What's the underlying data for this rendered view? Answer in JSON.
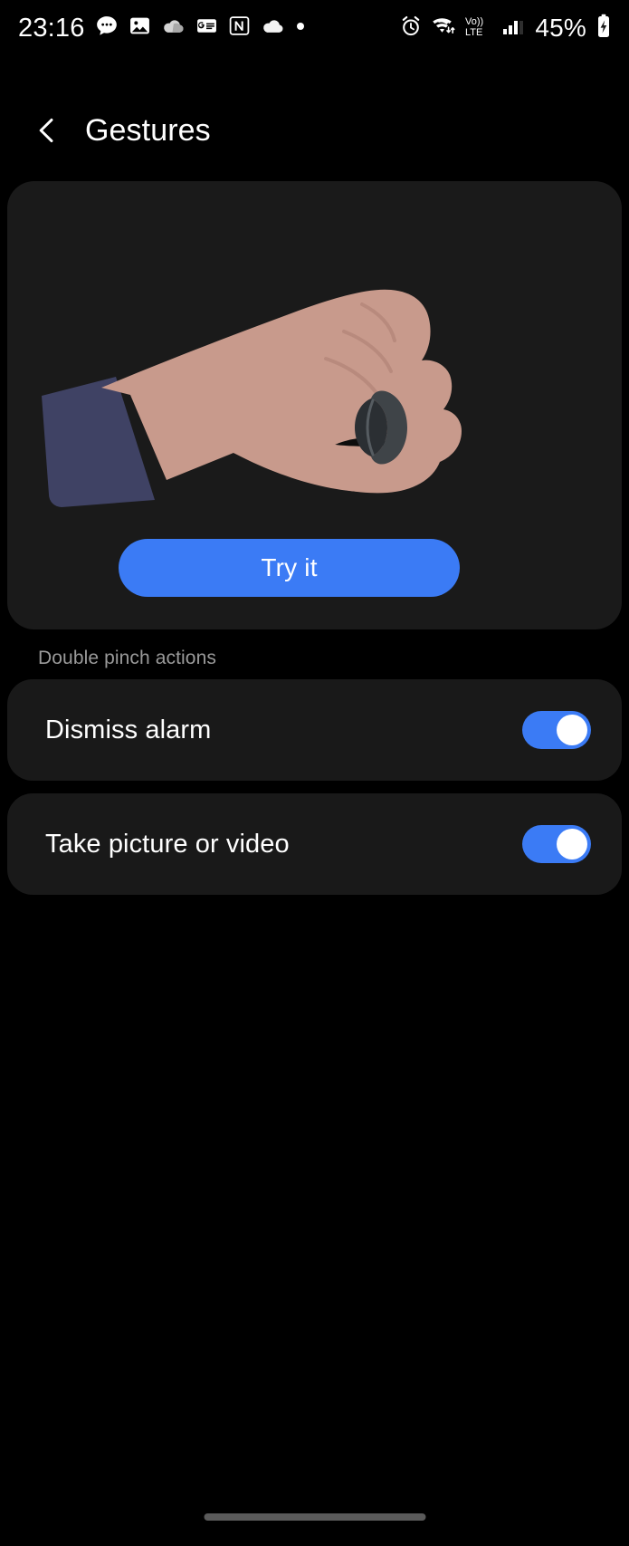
{
  "status_bar": {
    "clock": "23:16",
    "battery_percent": "45%",
    "left_icons": [
      "chat-bubble-icon",
      "photo-image-icon",
      "cloud-gray-icon",
      "google-news-icon",
      "letter-n-icon",
      "cloud-white-icon",
      "dot-icon"
    ],
    "right_icons": [
      "alarm-clock-icon",
      "wifi-data-transfer-icon",
      "volte-icon",
      "signal-bars-icon",
      "battery-charging-icon"
    ],
    "volte_top": "Vo))",
    "volte_bottom": "LTE"
  },
  "header": {
    "back_label": "Back",
    "title": "Gestures"
  },
  "hero": {
    "illustration_name": "hand-with-smart-ring-pinch-illustration",
    "try_button_label": "Try it",
    "accent_color": "#3b7bf5",
    "card_color": "#1a1a1a",
    "skin_color": "#c89a8c",
    "sleeve_color": "#3f4264",
    "ring_color": "#3f4448"
  },
  "section": {
    "label": "Double pinch actions"
  },
  "settings": [
    {
      "label": "Dismiss alarm",
      "enabled": true
    },
    {
      "label": "Take picture or video",
      "enabled": true
    }
  ],
  "nav": {
    "pill_name": "home-gesture-pill"
  }
}
